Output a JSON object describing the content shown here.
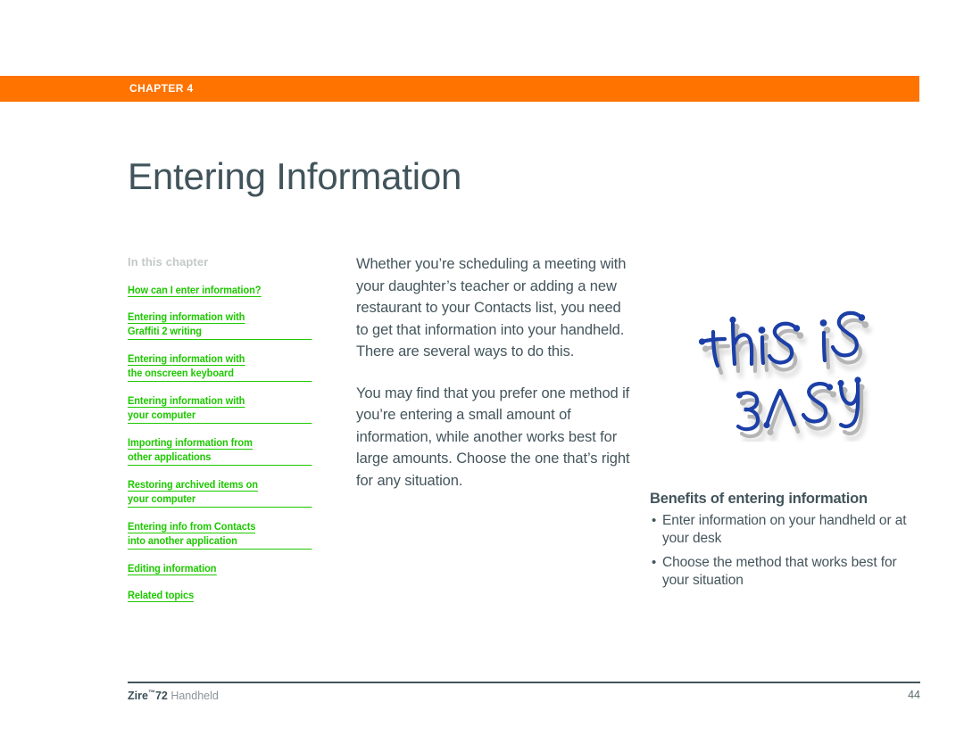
{
  "document": {
    "chapter_label": "CHAPTER 4",
    "title": "Entering Information",
    "accent_orange": "#ff7300",
    "link_green": "#1ec800",
    "text_slate": "#44555c",
    "heading_gray": "#c3c9c9"
  },
  "toc": {
    "heading": "In this chapter",
    "items": [
      {
        "line1": "How can I enter information?",
        "line2": ""
      },
      {
        "line1": "Entering information with ",
        "line2": "Graffiti 2 writing"
      },
      {
        "line1": "Entering information with ",
        "line2": "the onscreen keyboard"
      },
      {
        "line1": "Entering information with ",
        "line2": "your computer"
      },
      {
        "line1": "Importing information from ",
        "line2": "other applications"
      },
      {
        "line1": "Restoring archived items on ",
        "line2": "your computer"
      },
      {
        "line1": "Entering info from Contacts ",
        "line2": "into another application"
      },
      {
        "line1": "Editing information",
        "line2": ""
      },
      {
        "line1": "Related topics",
        "line2": ""
      }
    ]
  },
  "body": {
    "paragraphs": [
      "Whether you’re scheduling a meeting with your daughter’s teacher or adding a new restaurant to your Contacts list, you need to get that information into your handheld. There are several ways to do this.",
      "You may find that you prefer one method if you’re entering a small amount of information, while another works best for large amounts. Choose the one that’s right for any situation."
    ]
  },
  "graphic": {
    "name": "graffiti-handwriting-this-is-easy",
    "text": "this is EASY",
    "ink_color": "#1b3fa6",
    "shadow_color": "#b9bec4"
  },
  "benefits": {
    "title": "Benefits of entering information",
    "bullet_glyph": "•",
    "items": [
      "Enter information on your handheld or at your desk",
      "Choose the method that works best for your situation"
    ]
  },
  "footer": {
    "brand": "Zire",
    "trademark": "™",
    "model": "72",
    "product": " Handheld",
    "page_number": "44"
  }
}
